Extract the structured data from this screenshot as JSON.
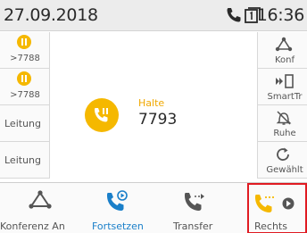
{
  "status": {
    "date": "27.09.2018",
    "time": "16:36",
    "phone_icon": "phone-icon",
    "line_icon": "line-key-icon"
  },
  "left_keys": [
    {
      "type": "hold",
      "number": ">7788",
      "icon": "hold-icon"
    },
    {
      "type": "hold",
      "number": ">7788",
      "icon": "hold-icon"
    },
    {
      "type": "line",
      "label": "Leitung"
    },
    {
      "type": "line",
      "label": "Leitung"
    }
  ],
  "right_keys": [
    {
      "label": "Konf",
      "icon": "conference-icon"
    },
    {
      "label": "SmartTr",
      "icon": "smart-transfer-icon"
    },
    {
      "label": "Ruhe",
      "icon": "do-not-disturb-icon"
    },
    {
      "label": "Gewählt",
      "icon": "redial-icon"
    }
  ],
  "call": {
    "state": "Halte",
    "number": "7793",
    "icon": "call-on-hold-icon"
  },
  "softkeys": [
    {
      "label": "Konferenz An",
      "icon": "conference-icon"
    },
    {
      "label": "Fortsetzen",
      "icon": "resume-call-icon"
    },
    {
      "label": "Transfer",
      "icon": "transfer-icon"
    },
    {
      "label": "Rechts",
      "icon": "more-right-icon"
    }
  ],
  "colors": {
    "accent_yellow": "#f5b800",
    "active_blue": "#1a7fc9",
    "highlight_red": "#e01b22",
    "statusbar_bg": "#ececec"
  }
}
